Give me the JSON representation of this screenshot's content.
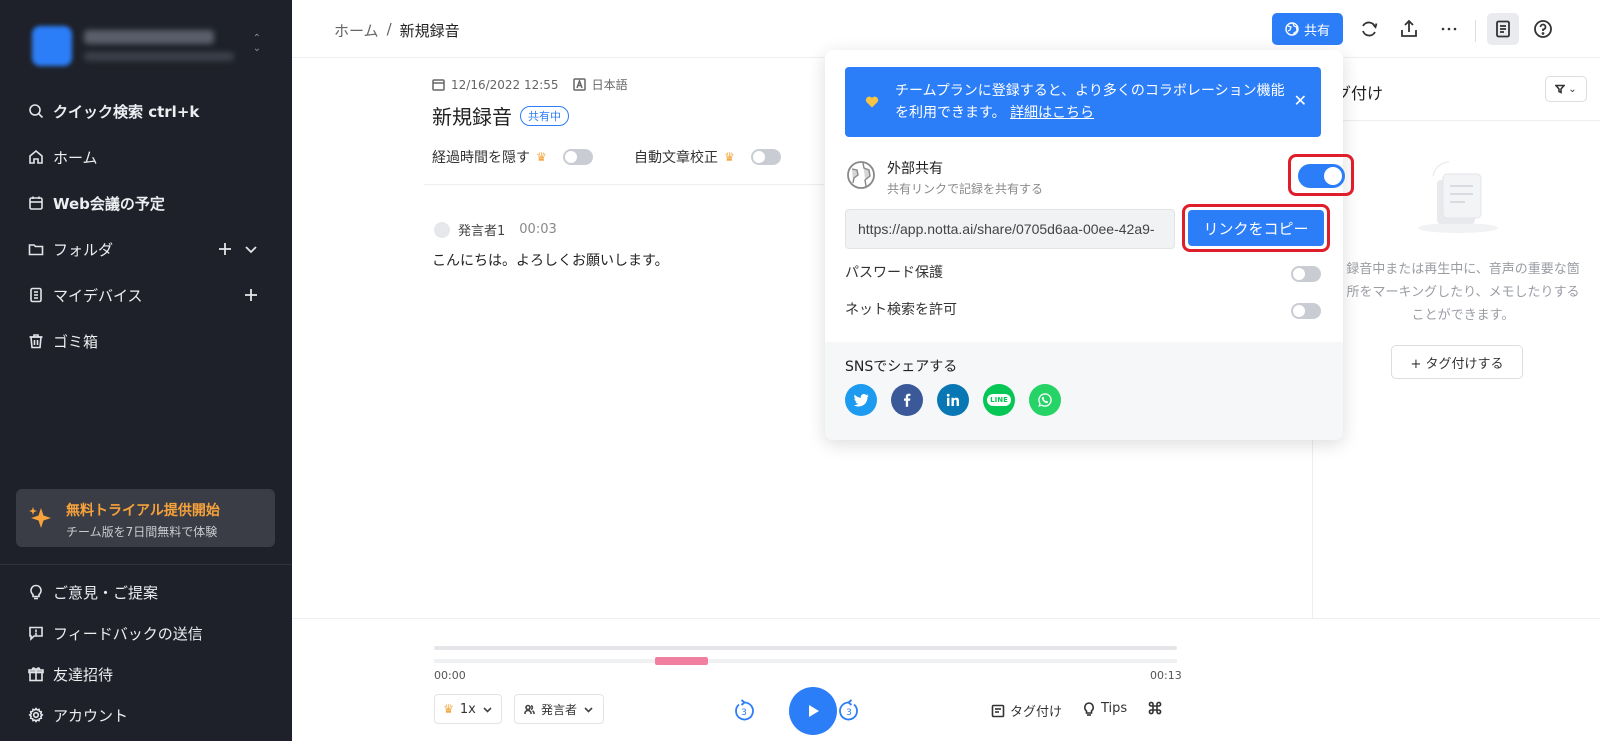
{
  "sidebar": {
    "workspace_name": "",
    "nav": [
      {
        "label": "クイック検索 ctrl+k",
        "icon": "search-icon"
      },
      {
        "label": "ホーム",
        "icon": "home-icon"
      },
      {
        "label": "Web会議の予定",
        "icon": "calendar-icon"
      },
      {
        "label": "フォルダ",
        "icon": "folder-icon"
      },
      {
        "label": "マイデバイス",
        "icon": "device-icon"
      },
      {
        "label": "ゴミ箱",
        "icon": "trash-icon"
      }
    ],
    "trial": {
      "title": "無料トライアル提供開始",
      "subtitle": "チーム版を7日間無料で体験"
    },
    "bottom_nav": [
      {
        "label": "ご意見・ご提案",
        "icon": "lightbulb-icon"
      },
      {
        "label": "フィードバックの送信",
        "icon": "feedback-icon"
      },
      {
        "label": "友達招待",
        "icon": "gift-icon"
      },
      {
        "label": "アカウント",
        "icon": "gear-icon"
      }
    ]
  },
  "header": {
    "breadcrumb": {
      "home": "ホーム",
      "separator": "/",
      "current": "新規録音"
    },
    "share_label": "共有"
  },
  "recording": {
    "datetime": "12/16/2022 12:55",
    "language": "日本語",
    "title": "新規録音",
    "status_badge": "共有中",
    "option_hide_elapsed": "経過時間を隠す",
    "option_auto_correct": "自動文章校正",
    "speaker": "発言者1",
    "speaker_time": "00:03",
    "transcript": "こんにちは。よろしくお願いします。"
  },
  "right_panel": {
    "title": "グ付け",
    "description": "録音中または再生中に、音声の重要な箇所をマーキングしたり、メモしたりすることができます。",
    "add_tag_label": "+ タグ付けする"
  },
  "share_popover": {
    "banner_text": "チームプランに登録すると、より多くのコラボレーション機能を利用できます。",
    "banner_link": "詳細はこちら",
    "external_share_title": "外部共有",
    "external_share_subtitle": "共有リンクで記録を共有する",
    "external_share_enabled": true,
    "share_url": "https://app.notta.ai/share/0705d6aa-00ee-42a9-",
    "copy_link_label": "リンクをコピー",
    "password_label": "パスワード保護",
    "password_enabled": false,
    "search_label": "ネット検索を許可",
    "search_enabled": false,
    "sns_title": "SNSでシェアする",
    "sns": [
      "twitter-icon",
      "facebook-icon",
      "linkedin-icon",
      "line-icon",
      "whatsapp-icon"
    ],
    "line_text": "LINE"
  },
  "player": {
    "time_start": "00:00",
    "time_end": "00:13",
    "speed": "1x",
    "speaker_filter": "発言者",
    "skip_back": "3",
    "skip_forward": "3",
    "tag_label": "タグ付け",
    "tips_label": "Tips"
  },
  "colors": {
    "accent": "#2c7ef8",
    "sidebar_bg": "#1e2129",
    "trial_text": "#f7a23b",
    "highlight_border": "#e01e2b",
    "track_mark": "#f07fa0"
  }
}
